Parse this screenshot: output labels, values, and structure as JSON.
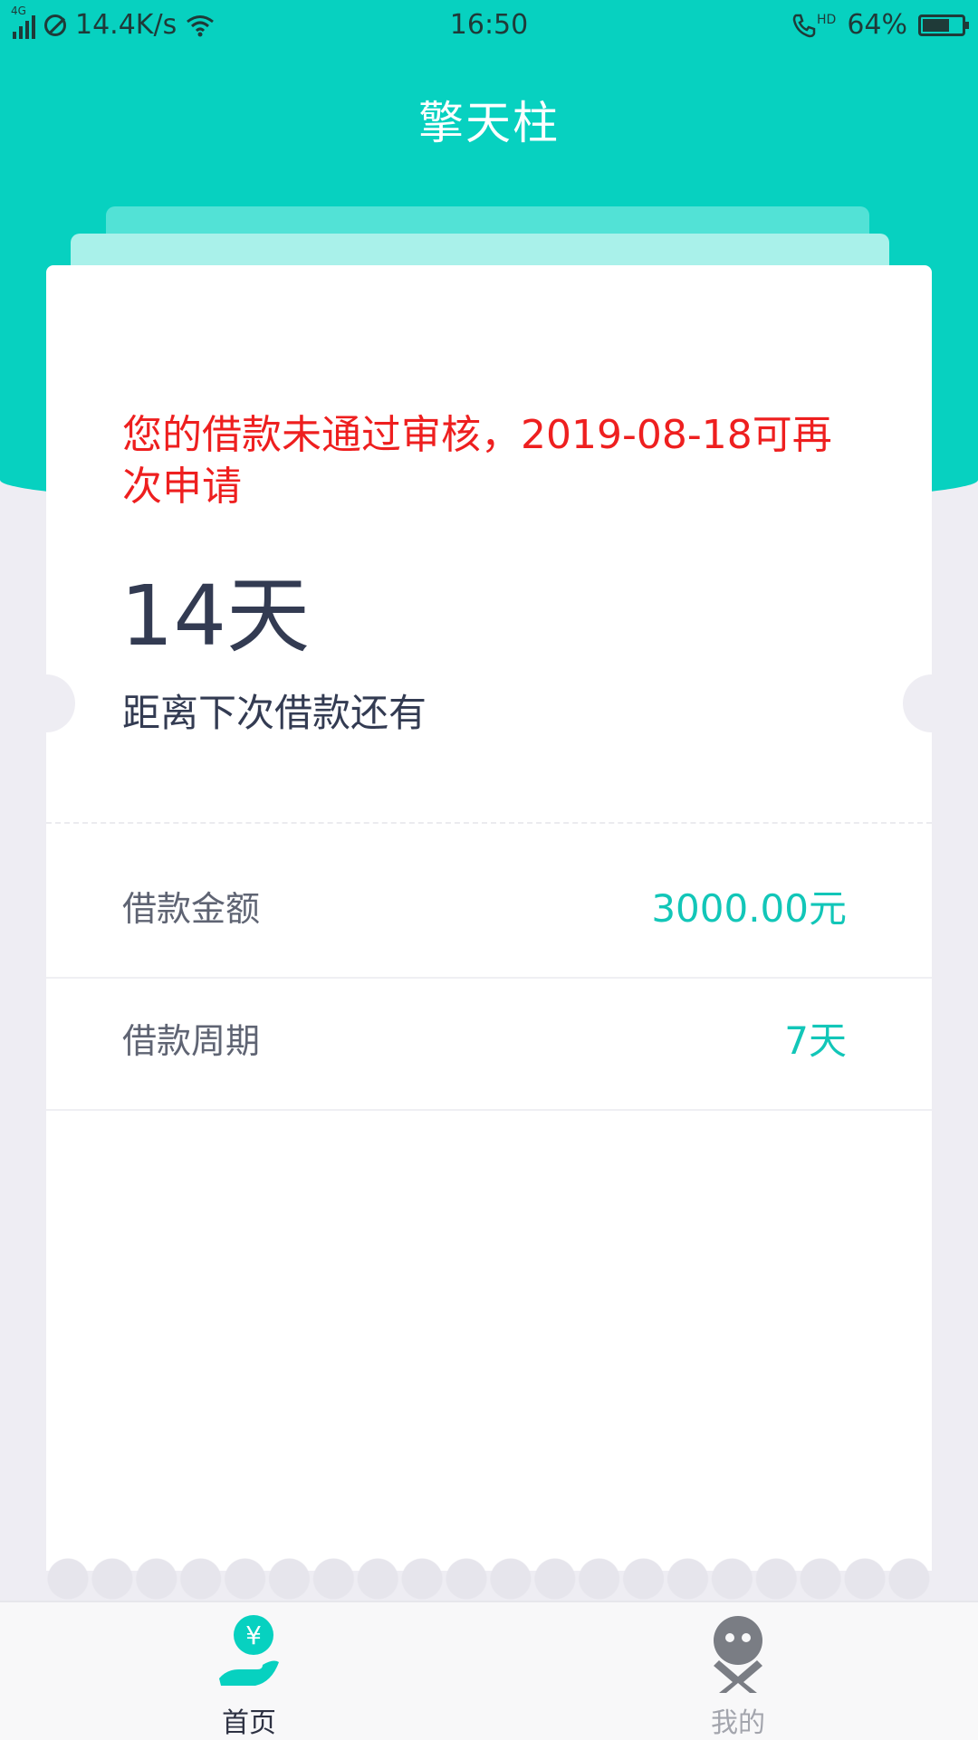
{
  "status_bar": {
    "network": "4G",
    "speed": "14.4K/s",
    "time": "16:50",
    "call_badge": "HD",
    "battery_percent": "64%",
    "battery_level": 0.64
  },
  "header": {
    "title": "擎天柱"
  },
  "card": {
    "reject_message": "您的借款未通过审核，2019-08-18可再次申请",
    "days_remaining": "14天",
    "days_label": "距离下次借款还有",
    "rows": [
      {
        "label": "借款金额",
        "value": "3000.00元"
      },
      {
        "label": "借款周期",
        "value": "7天"
      }
    ]
  },
  "tabbar": {
    "items": [
      {
        "label": "首页",
        "icon": "yuan-hand-icon",
        "active": true
      },
      {
        "label": "我的",
        "icon": "profile-face-icon",
        "active": false
      }
    ]
  },
  "colors": {
    "accent": "#07d1c0",
    "error": "#ee1f1f",
    "value": "#12c6b8",
    "text_dark": "#333b52"
  }
}
